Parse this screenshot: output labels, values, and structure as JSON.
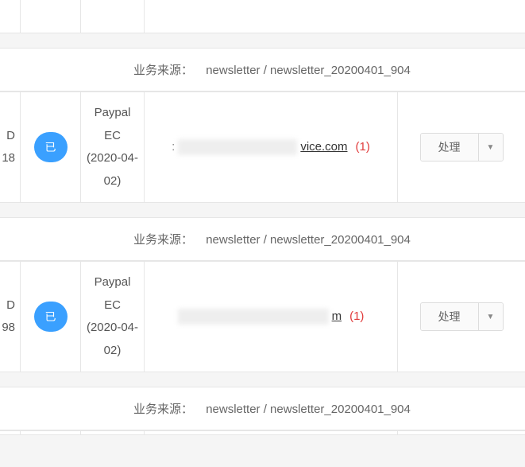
{
  "labels": {
    "source": "业务来源：",
    "action": "处理"
  },
  "source_value": "newsletter / newsletter_20200401_904",
  "rows": [
    {
      "id_frag_top": "D",
      "id_frag_bot": "18",
      "status": "已",
      "gateway": "Paypal EC",
      "date": "(2020-04-02)",
      "email_suffix": "vice.com",
      "count": "(1)"
    },
    {
      "id_frag_top": "D",
      "id_frag_bot": "98",
      "status": "已",
      "gateway": "Paypal EC",
      "date": "(2020-04-02)",
      "email_suffix": "m",
      "count": "(1)"
    }
  ]
}
